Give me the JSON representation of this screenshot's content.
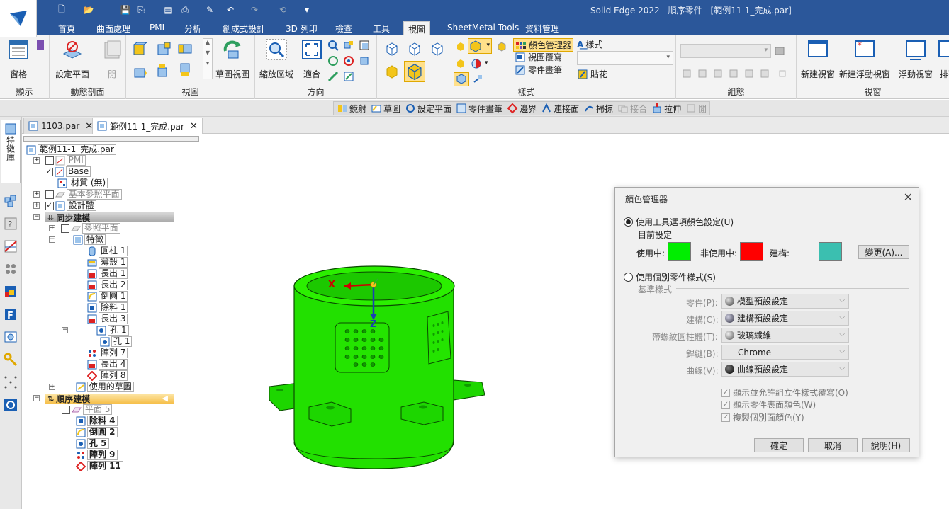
{
  "title": "Solid Edge 2022 - 順序零件 - [範例11-1_完成.par]",
  "ribbon_tabs": [
    "首頁",
    "曲面處理",
    "PMI",
    "分析",
    "創成式設計",
    "3D 列印",
    "檢查",
    "工具",
    "視圖",
    "SheetMetal Tools",
    "資料管理"
  ],
  "active_tab": "視圖",
  "groups": {
    "show": {
      "label": "顯示",
      "window": "窗格"
    },
    "dynamic_section": {
      "label": "動態剖面",
      "set_plane": "設定平面",
      "close": "閒"
    },
    "views": {
      "label": "視圖",
      "sketch_view": "草圖視圖"
    },
    "orient": {
      "label": "方向",
      "zoom_area": "縮放區域",
      "fit": "適合"
    },
    "style": {
      "label": "樣式",
      "color_manager": "顏色管理器",
      "view_override": "視圖覆寫",
      "part_painter": "零件畫筆",
      "styles": "樣式",
      "decal": "貼花"
    },
    "assembly": {
      "label": "組態"
    },
    "window": {
      "label": "視窗",
      "new_window": "新建視窗",
      "new_floating": "新建浮動視窗",
      "floating": "浮動視窗",
      "arrange": "排列"
    }
  },
  "command_bar": [
    {
      "label": "鏡射",
      "enabled": true
    },
    {
      "label": "草圖",
      "enabled": true
    },
    {
      "label": "設定平面",
      "enabled": true
    },
    {
      "label": "零件畫筆",
      "enabled": true
    },
    {
      "label": "邊界",
      "enabled": true
    },
    {
      "label": "連接面",
      "enabled": true
    },
    {
      "label": "掃掠",
      "enabled": true
    },
    {
      "label": "接合",
      "enabled": false
    },
    {
      "label": "拉伸",
      "enabled": true
    },
    {
      "label": "閒",
      "enabled": false
    }
  ],
  "left_tab": "特徵庫",
  "doc_tabs": [
    {
      "label": "1103.par",
      "active": false
    },
    {
      "label": "範例11-1_完成.par",
      "active": true
    }
  ],
  "tree": {
    "root": "範例11-1_完成.par",
    "pmi": "PMI",
    "base": "Base",
    "material": "材質 (無)",
    "base_planes": "基本參照平面",
    "design_body": "設計體",
    "sync_header": "同步建模",
    "ref_planes": "參照平面",
    "features": "特徵",
    "cylinder": "圓柱 1",
    "thin_wall": "薄殼 1",
    "extrude1": "長出 1",
    "extrude2": "長出 2",
    "round1": "倒圓 1",
    "cut1": "除料 1",
    "extrude3": "長出 3",
    "hole_group": "孔 1",
    "hole1": "孔 1",
    "pattern7": "陣列 7",
    "extrude4": "長出 4",
    "pattern8": "陣列 8",
    "used_sketches": "使用的草圖",
    "ordered_header": "順序建模",
    "plane5": "平面 5",
    "cut4": "除料 4",
    "round2": "倒圓 2",
    "hole5": "孔 5",
    "pattern9": "陣列 9",
    "pattern11": "陣列 11"
  },
  "viewport": {
    "axis_x": "X",
    "axis_z": "Z",
    "model_color": "#22e000"
  },
  "dialog": {
    "title": "顏色管理器",
    "opt_tool": "使用工具選項顏色設定(U)",
    "current": "目前設定",
    "active_label": "使用中:",
    "inactive_label": "非使用中:",
    "construction_label": "建構:",
    "active_color": "#00ee00",
    "inactive_color": "#ff0000",
    "construction_color": "#3bbfb0",
    "change_btn": "變更(A)...",
    "opt_individual": "使用個別零件樣式(S)",
    "base_style": "基準樣式",
    "part_label": "零件(P):",
    "part_value": "模型預設設定",
    "construct_label": "建構(C):",
    "construct_value": "建構預設設定",
    "thread_label": "帶螺紋圓柱體(T):",
    "thread_value": "玻璃纖維",
    "weld_label": "銲縫(B):",
    "weld_value": "Chrome",
    "curve_label": "曲線(V):",
    "curve_value": "曲線預設設定",
    "cb1": "顯示並允許組立件樣式覆寫(O)",
    "cb2": "顯示零件表面顏色(W)",
    "cb3": "複製個別面顏色(Y)",
    "ok": "確定",
    "cancel": "取消",
    "help": "說明(H)"
  }
}
